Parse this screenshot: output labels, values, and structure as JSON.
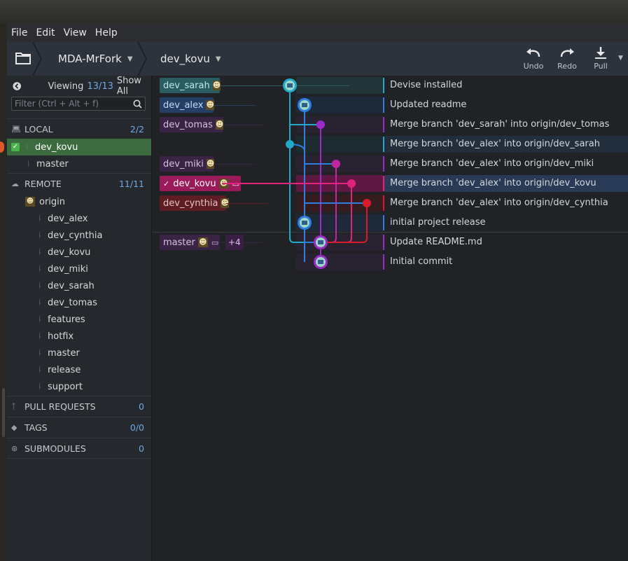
{
  "menu": {
    "file": "File",
    "edit": "Edit",
    "view": "View",
    "help": "Help"
  },
  "toolbar": {
    "repo": "MDA-MrFork",
    "branch": "dev_kovu",
    "undo": "Undo",
    "redo": "Redo",
    "pull": "Pull"
  },
  "sidebar": {
    "viewing_label": "Viewing",
    "viewing_count": "13/13",
    "show_all": "Show All",
    "filter_placeholder": "Filter (Ctrl + Alt + f)",
    "local": {
      "label": "LOCAL",
      "count": "2/2",
      "branches": [
        "dev_kovu",
        "master"
      ]
    },
    "remote": {
      "label": "REMOTE",
      "count": "11/11",
      "origin": "origin",
      "branches": [
        "dev_alex",
        "dev_cynthia",
        "dev_kovu",
        "dev_miki",
        "dev_sarah",
        "dev_tomas",
        "features",
        "hotfix",
        "master",
        "release",
        "support"
      ]
    },
    "pull_requests": {
      "label": "PULL REQUESTS",
      "count": "0"
    },
    "tags": {
      "label": "TAGS",
      "count": "0/0"
    },
    "submodules": {
      "label": "SUBMODULES",
      "count": "0"
    }
  },
  "graph": {
    "refs": [
      {
        "label": "dev_sarah",
        "row": 0,
        "color": "#2a5d62",
        "text": "#bfe6ea"
      },
      {
        "label": "dev_alex",
        "row": 1,
        "color": "#233f66",
        "text": "#c6d8f2"
      },
      {
        "label": "dev_tomas",
        "row": 2,
        "color": "#3a2446",
        "text": "#d5c2e0"
      },
      {
        "label": "dev_miki",
        "row": 4,
        "color": "#3a2446",
        "text": "#d5c2e0"
      },
      {
        "label": "dev_kovu",
        "row": 5,
        "color": "#9b1a5a",
        "text": "#ffffff"
      },
      {
        "label": "dev_cynthia",
        "row": 6,
        "color": "#5e1d22",
        "text": "#e6c2c4"
      },
      {
        "label": "master",
        "row": 8,
        "color": "#3a2446",
        "text": "#d5c2e0"
      }
    ],
    "more_label": "+4",
    "commits": [
      {
        "msg": "Devise installed"
      },
      {
        "msg": "Updated readme"
      },
      {
        "msg": "Merge branch 'dev_sarah' into origin/dev_tomas"
      },
      {
        "msg": "Merge branch 'dev_alex' into origin/dev_sarah"
      },
      {
        "msg": "Merge branch 'dev_alex' into origin/dev_miki"
      },
      {
        "msg": "Merge branch 'dev_alex' into origin/dev_kovu"
      },
      {
        "msg": "Merge branch 'dev_alex' into origin/dev_cynthia"
      },
      {
        "msg": "initial project release"
      },
      {
        "msg": "Update README.md"
      },
      {
        "msg": "Initial commit"
      }
    ]
  },
  "colors": {
    "cyan": "#22a9c9",
    "blue": "#2f7fe0",
    "purple": "#9a2bc6",
    "magenta": "#c0269f",
    "pink": "#e2237e",
    "red": "#d81b2c",
    "accent": "#6fa9e6"
  }
}
